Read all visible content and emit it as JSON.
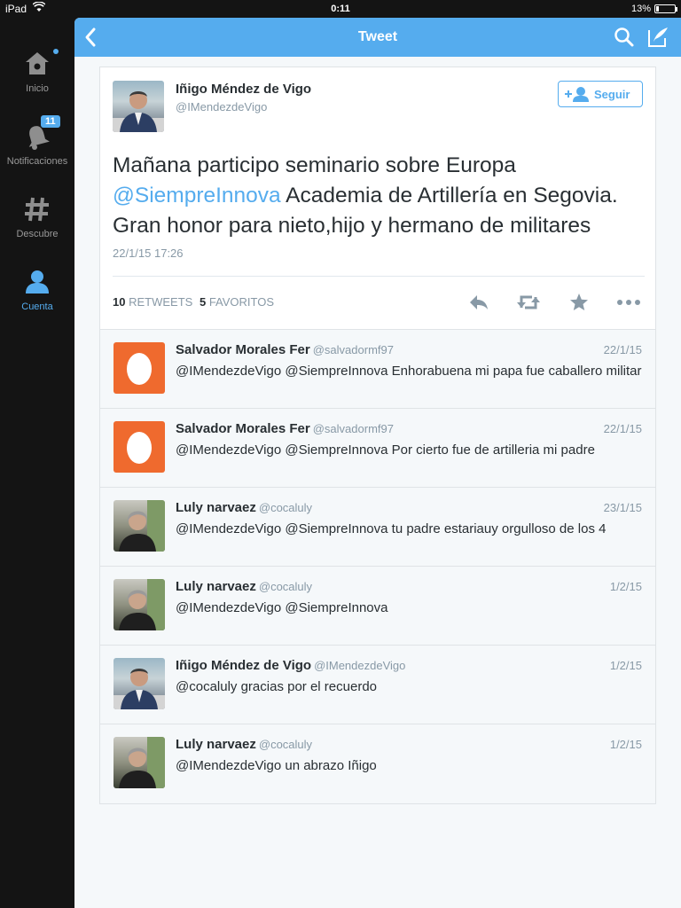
{
  "status_bar": {
    "carrier": "iPad",
    "time": "0:11",
    "battery": "13%",
    "battery_level": 0.13
  },
  "sidebar": {
    "items": [
      {
        "label": "Inicio",
        "icon": "home-icon"
      },
      {
        "label": "Notificaciones",
        "icon": "bell-icon",
        "badge": "11"
      },
      {
        "label": "Descubre",
        "icon": "hashtag-icon"
      },
      {
        "label": "Cuenta",
        "icon": "person-icon",
        "active": true
      }
    ]
  },
  "nav": {
    "title": "Tweet"
  },
  "tweet": {
    "author_name": "Iñigo Méndez de Vigo",
    "author_handle": "@IMendezdeVigo",
    "follow_label": "Seguir",
    "text_part1": "Mañana participo seminario sobre Europa",
    "mention": "@SiempreInnova",
    "text_part2": "Academia de Artillería en Segovia. Gran honor para nieto,hijo y hermano de militares",
    "date": "22/1/15 17:26",
    "retweets_count": "10",
    "retweets_label": "RETWEETS",
    "favorites_count": "5",
    "favorites_label": "FAVORITOS"
  },
  "replies": [
    {
      "name": "Salvador Morales Fer",
      "handle": "@salvadormf97",
      "date": "22/1/15",
      "text": "@IMendezdeVigo @SiempreInnova Enhorabuena mi papa fue caballero militar",
      "avatar": "egg"
    },
    {
      "name": "Salvador Morales Fer",
      "handle": "@salvadormf97",
      "date": "22/1/15",
      "text": "@IMendezdeVigo @SiempreInnova Por cierto fue de artilleria mi padre",
      "avatar": "egg"
    },
    {
      "name": "Luly narvaez",
      "handle": "@cocaluly",
      "date": "23/1/15",
      "text": "@IMendezdeVigo @SiempreInnova tu padre estariauy orgulloso de los 4",
      "avatar": "woman"
    },
    {
      "name": "Luly narvaez",
      "handle": "@cocaluly",
      "date": "1/2/15",
      "text": "@IMendezdeVigo @SiempreInnova",
      "avatar": "woman"
    },
    {
      "name": "Iñigo Méndez de Vigo",
      "handle": "@IMendezdeVigo",
      "date": "1/2/15",
      "text": "@cocaluly gracias por el recuerdo",
      "avatar": "man"
    },
    {
      "name": "Luly narvaez",
      "handle": "@cocaluly",
      "date": "1/2/15",
      "text": "@IMendezdeVigo un abrazo Iñigo",
      "avatar": "woman"
    }
  ],
  "colors": {
    "accent": "#55acee",
    "egg_background": "#ef6a2e",
    "text": "#292f33",
    "muted": "#8899a6"
  }
}
